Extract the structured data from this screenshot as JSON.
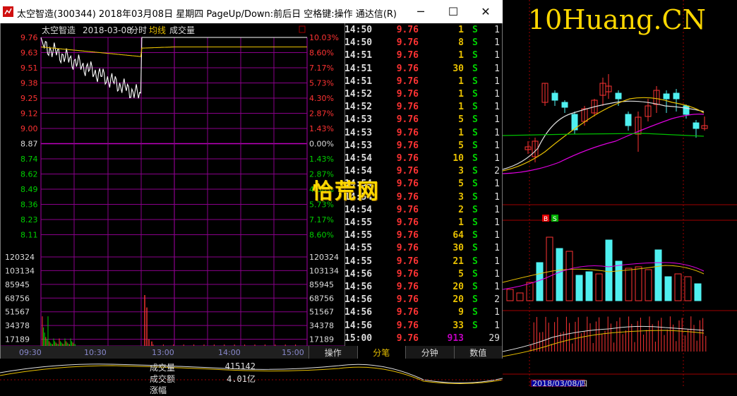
{
  "window": {
    "title": "太空智造(300344) 2018年03月08日 星期四 PageUp/Down:前后日 空格键:操作 通达信(R)",
    "minimize": "─",
    "maximize": "☐",
    "close": "✕"
  },
  "chart": {
    "stock_name": "太空智造",
    "date": "2018-03-08",
    "mode": "分时",
    "legend_avg": "均线",
    "legend_vol": "成交量",
    "price_labels": [
      "9.76",
      "9.63",
      "9.51",
      "9.38",
      "9.25",
      "9.12",
      "9.00",
      "8.87",
      "8.74",
      "8.62",
      "8.49",
      "8.36",
      "8.23",
      "8.11"
    ],
    "pct_labels": [
      "10.03%",
      "8.60%",
      "7.17%",
      "5.73%",
      "4.30%",
      "2.87%",
      "1.43%",
      "0.00%",
      "1.43%",
      "2.87%",
      "4.30%",
      "5.73%",
      "7.17%",
      "8.60%"
    ],
    "vol_labels": [
      "120324",
      "103134",
      "85945",
      "68756",
      "51567",
      "34378",
      "17189"
    ],
    "time_labels": [
      "09:30",
      "10:30",
      "13:00",
      "14:00",
      "15:00"
    ]
  },
  "chart_data": {
    "type": "line",
    "title": "",
    "x": [
      "09:30",
      "10:30",
      "13:00",
      "14:00",
      "15:00"
    ],
    "ylim": [
      7.98,
      9.76
    ],
    "prev_close": 8.87,
    "series": [
      {
        "name": "",
        "values": [
          9.7,
          9.45,
          9.3,
          9.27,
          9.76,
          9.76,
          9.76
        ]
      },
      {
        "name": "均线",
        "values": [
          9.68,
          9.64,
          9.62,
          9.6,
          9.67,
          9.68,
          9.68
        ]
      }
    ],
    "volume": {
      "ylim": [
        0,
        120324
      ],
      "peaks": [
        {
          "time": "13:00",
          "value": 68756
        }
      ]
    },
    "colors": {
      "price": "#ffffff",
      "avg": "#e8c000",
      "grid": "#a000a0",
      "up": "#ff3333",
      "down": "#00d000"
    }
  },
  "tabs": [
    "操作",
    "分笔",
    "分钟",
    "数值"
  ],
  "ticks": [
    {
      "time": "14:50",
      "price": "9.76",
      "vol": "1",
      "side": "S",
      "cnt": "1"
    },
    {
      "time": "14:50",
      "price": "9.76",
      "vol": "8",
      "side": "S",
      "cnt": "1"
    },
    {
      "time": "14:51",
      "price": "9.76",
      "vol": "1",
      "side": "S",
      "cnt": "1"
    },
    {
      "time": "14:51",
      "price": "9.76",
      "vol": "30",
      "side": "S",
      "cnt": "1"
    },
    {
      "time": "14:51",
      "price": "9.76",
      "vol": "1",
      "side": "S",
      "cnt": "1"
    },
    {
      "time": "14:52",
      "price": "9.76",
      "vol": "1",
      "side": "S",
      "cnt": "1"
    },
    {
      "time": "14:52",
      "price": "9.76",
      "vol": "1",
      "side": "S",
      "cnt": "1"
    },
    {
      "time": "14:53",
      "price": "9.76",
      "vol": "5",
      "side": "S",
      "cnt": "1"
    },
    {
      "time": "14:53",
      "price": "9.76",
      "vol": "1",
      "side": "S",
      "cnt": "1"
    },
    {
      "time": "14:53",
      "price": "9.76",
      "vol": "5",
      "side": "S",
      "cnt": "1"
    },
    {
      "time": "14:54",
      "price": "9.76",
      "vol": "10",
      "side": "S",
      "cnt": "1"
    },
    {
      "time": "14:54",
      "price": "9.76",
      "vol": "3",
      "side": "S",
      "cnt": "2"
    },
    {
      "time": "14:54",
      "price": "9.76",
      "vol": "5",
      "side": "S",
      "cnt": "1"
    },
    {
      "time": "14:54",
      "price": "9.76",
      "vol": "3",
      "side": "S",
      "cnt": "1"
    },
    {
      "time": "14:54",
      "price": "9.76",
      "vol": "2",
      "side": "S",
      "cnt": "1"
    },
    {
      "time": "14:55",
      "price": "9.76",
      "vol": "1",
      "side": "S",
      "cnt": "1"
    },
    {
      "time": "14:55",
      "price": "9.76",
      "vol": "64",
      "side": "S",
      "cnt": "1"
    },
    {
      "time": "14:55",
      "price": "9.76",
      "vol": "30",
      "side": "S",
      "cnt": "1"
    },
    {
      "time": "14:55",
      "price": "9.76",
      "vol": "21",
      "side": "S",
      "cnt": "1"
    },
    {
      "time": "14:56",
      "price": "9.76",
      "vol": "5",
      "side": "S",
      "cnt": "1"
    },
    {
      "time": "14:56",
      "price": "9.76",
      "vol": "20",
      "side": "S",
      "cnt": "1"
    },
    {
      "time": "14:56",
      "price": "9.76",
      "vol": "20",
      "side": "S",
      "cnt": "2"
    },
    {
      "time": "14:56",
      "price": "9.76",
      "vol": "9",
      "side": "S",
      "cnt": "1"
    },
    {
      "time": "14:56",
      "price": "9.76",
      "vol": "33",
      "side": "S",
      "cnt": "1"
    },
    {
      "time": "15:00",
      "price": "9.76",
      "vol": "913",
      "side": "",
      "cnt": "29"
    }
  ],
  "watermark": "10Huang.CN",
  "logo_text": "恰荒网",
  "bottom_info": [
    {
      "label": "成交量",
      "value": "415142"
    },
    {
      "label": "成交额",
      "value": "4.01亿"
    },
    {
      "label": "涨幅",
      "value": ""
    }
  ],
  "right_panel": {
    "date_label": "2018/03/08/四",
    "b_mark": "B",
    "s_mark": "S"
  }
}
